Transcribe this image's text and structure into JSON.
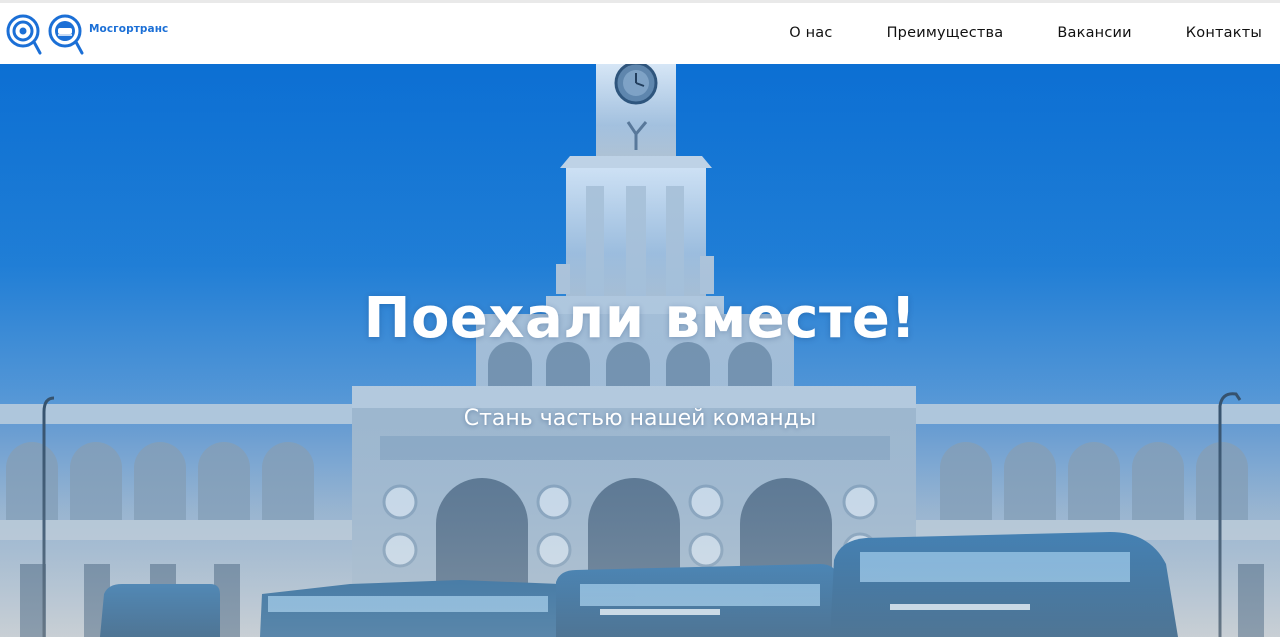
{
  "brand": {
    "name": "Мосгортранс",
    "color": "#1b6fd6"
  },
  "nav": {
    "items": [
      {
        "label": "О нас"
      },
      {
        "label": "Преимущества"
      },
      {
        "label": "Вакансии"
      },
      {
        "label": "Контакты"
      }
    ]
  },
  "hero": {
    "title": "Поехали вместе!",
    "subtitle": "Стань частью нашей команды",
    "overlay_color": "#0c6fd3"
  }
}
